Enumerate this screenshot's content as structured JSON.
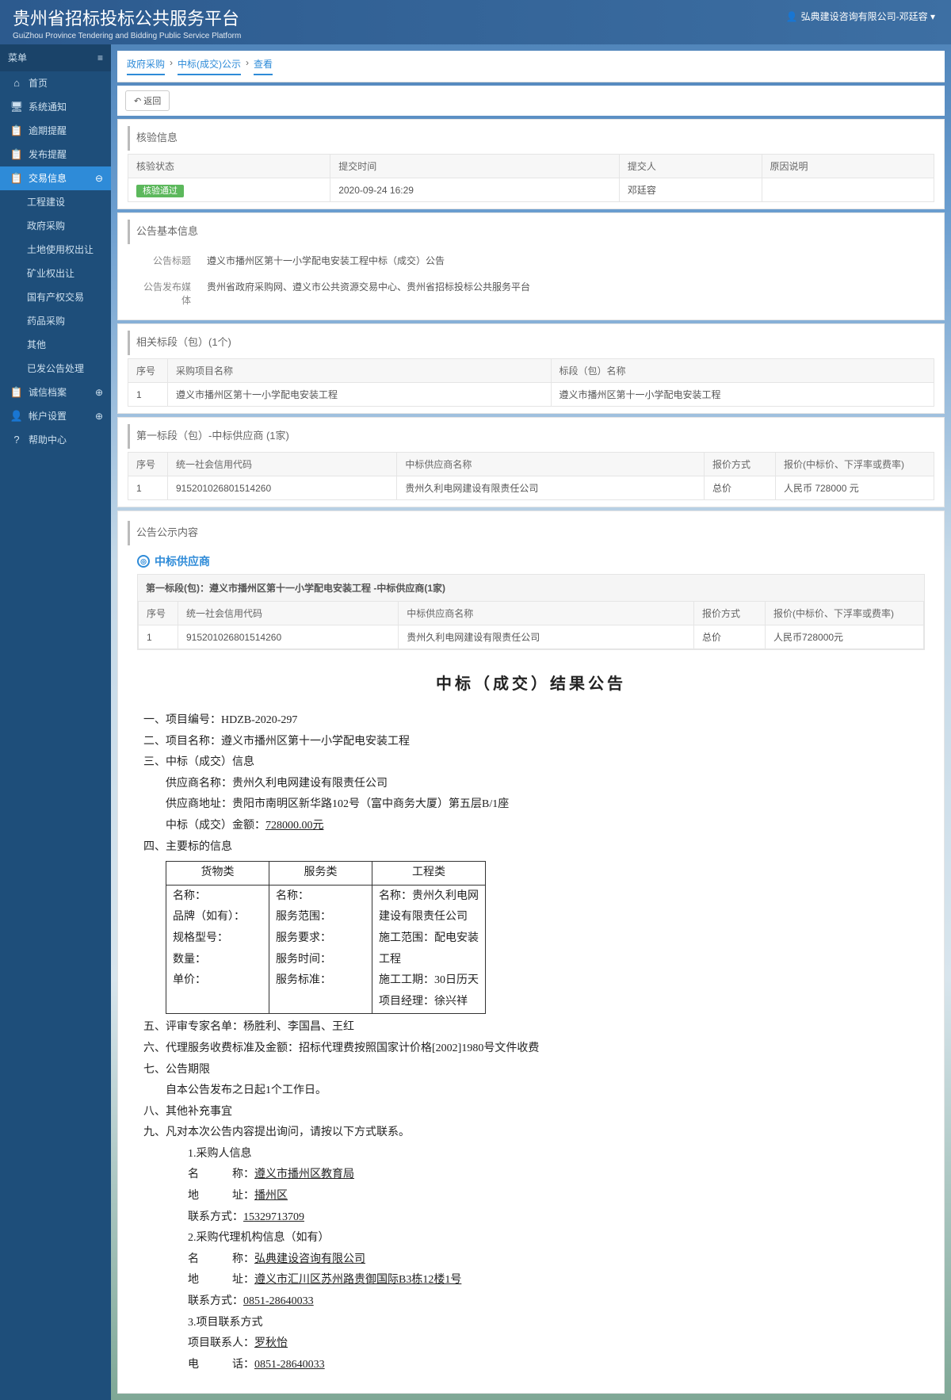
{
  "header": {
    "title": "贵州省招标投标公共服务平台",
    "subtitle": "GuiZhou Province Tendering and Bidding Public Service Platform",
    "user": "弘典建设咨询有限公司-邓廷容"
  },
  "sidebar": {
    "menu_label": "菜单",
    "items": [
      {
        "icon": "⌂",
        "label": "首页"
      },
      {
        "icon": "🖥",
        "label": "系统通知"
      },
      {
        "icon": "📋",
        "label": "逾期提醒"
      },
      {
        "icon": "📋",
        "label": "发布提醒"
      },
      {
        "icon": "📋",
        "label": "交易信息"
      },
      {
        "icon": "📋",
        "label": "诚信档案"
      },
      {
        "icon": "👤",
        "label": "帐户设置"
      },
      {
        "icon": "?",
        "label": "帮助中心"
      }
    ],
    "sub_items": [
      "工程建设",
      "政府采购",
      "土地使用权出让",
      "矿业权出让",
      "国有产权交易",
      "药品采购",
      "其他",
      "已发公告处理"
    ]
  },
  "breadcrumb": [
    "政府采购",
    "中标(成交)公示",
    "查看"
  ],
  "back_label": "↶ 返回",
  "verify": {
    "title": "核验信息",
    "headers": [
      "核验状态",
      "提交时间",
      "提交人",
      "原因说明"
    ],
    "row": {
      "status": "核验通过",
      "time": "2020-09-24 16:29",
      "person": "邓廷容",
      "reason": ""
    }
  },
  "basic": {
    "title": "公告基本信息",
    "rows": [
      {
        "label": "公告标题",
        "value": "遵义市播州区第十一小学配电安装工程中标（成交）公告"
      },
      {
        "label": "公告发布媒体",
        "value": "贵州省政府采购网、遵义市公共资源交易中心、贵州省招标投标公共服务平台"
      }
    ]
  },
  "sections": {
    "title": "相关标段（包）(1个)",
    "headers": [
      "序号",
      "采购项目名称",
      "标段（包）名称"
    ],
    "row": [
      "1",
      "遵义市播州区第十一小学配电安装工程",
      "遵义市播州区第十一小学配电安装工程"
    ]
  },
  "supplier1": {
    "title": "第一标段（包）-中标供应商 (1家)",
    "headers": [
      "序号",
      "统一社会信用代码",
      "中标供应商名称",
      "报价方式",
      "报价(中标价、下浮率或费率)"
    ],
    "row": [
      "1",
      "915201026801514260",
      "贵州久利电网建设有限责任公司",
      "总价",
      "人民币 728000 元"
    ]
  },
  "content": {
    "title": "公告公示内容",
    "supplier_head": "中标供应商",
    "sub_title": "第一标段(包)：遵义市播州区第十一小学配电安装工程 -中标供应商(1家)",
    "tbl_headers": [
      "序号",
      "统一社会信用代码",
      "中标供应商名称",
      "报价方式",
      "报价(中标价、下浮率或费率)"
    ],
    "tbl_row": [
      "1",
      "915201026801514260",
      "贵州久利电网建设有限责任公司",
      "总价",
      "人民币728000元"
    ]
  },
  "announce": {
    "heading": "中标（成交）结果公告",
    "line1": "一、项目编号：HDZB-2020-297",
    "line2": "二、项目名称：遵义市播州区第十一小学配电安装工程",
    "line3": "三、中标（成交）信息",
    "supplier_name": "供应商名称：贵州久利电网建设有限责任公司",
    "supplier_addr": "供应商地址：贵阳市南明区新华路102号（富中商务大厦）第五层B/1座",
    "amount_label": "中标（成交）金额：",
    "amount": "728000.00元",
    "line4": "四、主要标的信息",
    "tbl": {
      "h1": "货物类",
      "h2": "服务类",
      "h3": "工程类",
      "c1": [
        "名称：",
        "品牌（如有）：",
        "规格型号：",
        "数量：",
        "单价："
      ],
      "c2": [
        "名称：",
        "服务范围：",
        "服务要求：",
        "服务时间：",
        "服务标准："
      ],
      "c3": [
        "名称：贵州久利电网",
        "建设有限责任公司",
        "施工范围：配电安装",
        "工程",
        "施工工期：30日历天",
        "项目经理：徐兴祥"
      ]
    },
    "line5": "五、评审专家名单：杨胜利、李国昌、王红",
    "line6": "六、代理服务收费标准及金额：招标代理费按照国家计价格[2002]1980号文件收费",
    "line7": "七、公告期限",
    "line7a": "自本公告发布之日起1个工作日。",
    "line8": "八、其他补充事宜",
    "line9": "九、凡对本次公告内容提出询问，请按以下方式联系。",
    "p1": "1.采购人信息",
    "p1_name_l": "名　　　称：",
    "p1_name_v": "遵义市播州区教育局",
    "p1_addr_l": "地　　　址：",
    "p1_addr_v": "播州区",
    "p1_tel_l": "联系方式：",
    "p1_tel_v": "15329713709",
    "p2": "2.采购代理机构信息（如有）",
    "p2_name_l": "名　　　称：",
    "p2_name_v": "弘典建设咨询有限公司",
    "p2_addr_l": "地　　　址：",
    "p2_addr_v": "遵义市汇川区苏州路贵御国际B3栋12楼1号",
    "p2_tel_l": "联系方式：",
    "p2_tel_v": "0851-28640033",
    "p3": "3.项目联系方式",
    "p3_name_l": "项目联系人：",
    "p3_name_v": "罗秋怡",
    "p3_tel_l": "电　　　话：",
    "p3_tel_v": "0851-28640033"
  }
}
